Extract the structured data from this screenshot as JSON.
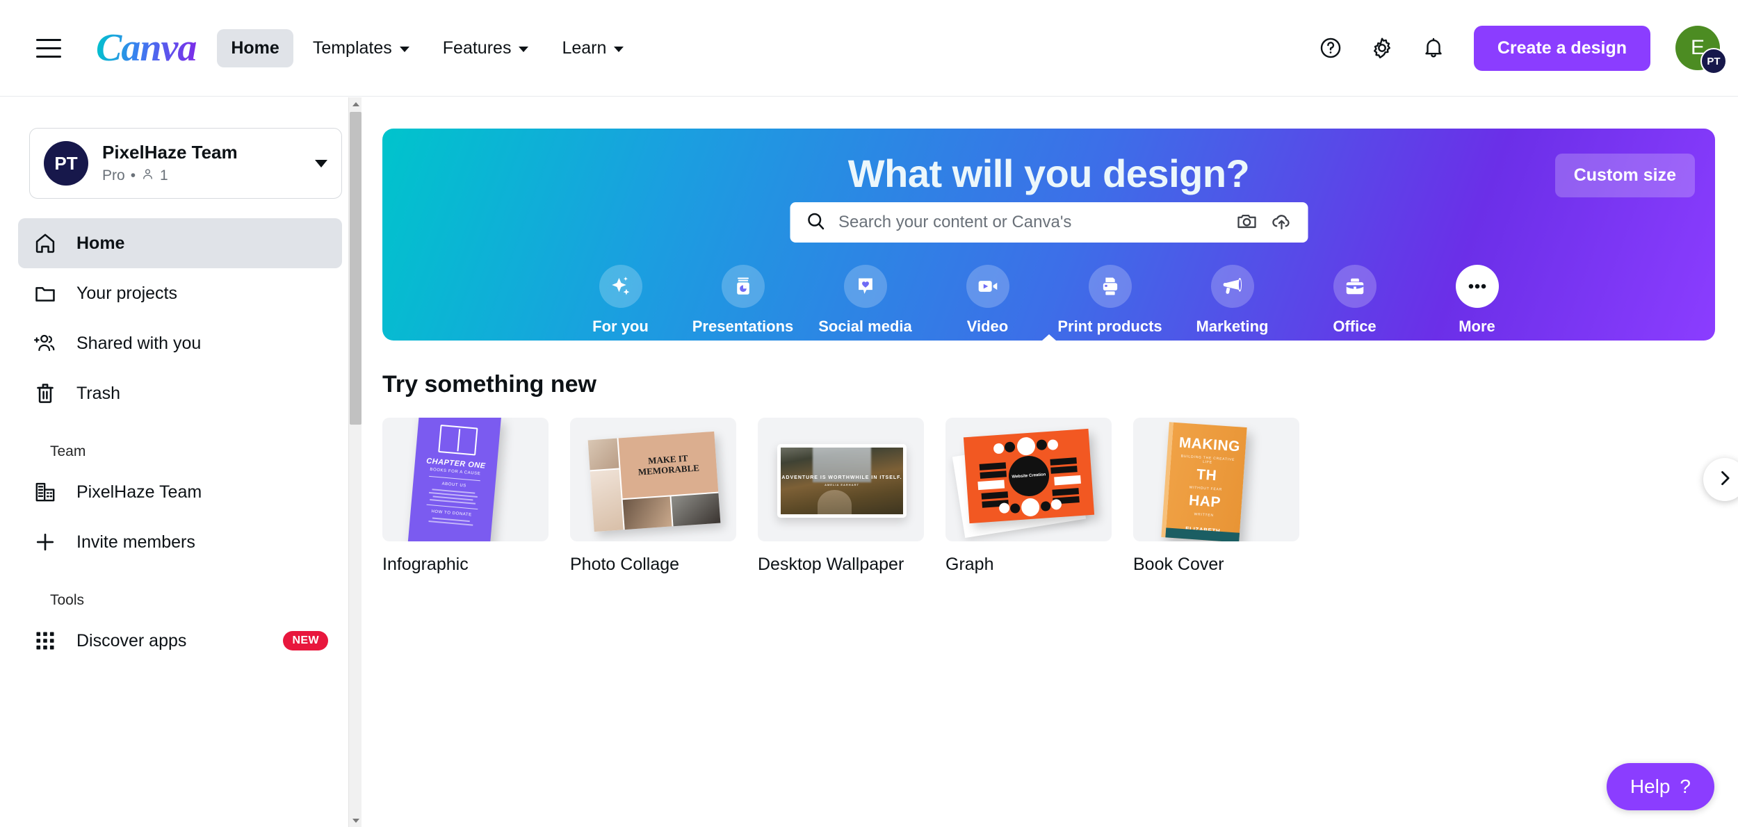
{
  "header": {
    "menu_icon": "hamburger-menu-icon",
    "logo_text": "Canva",
    "nav": [
      {
        "label": "Home",
        "active": true,
        "has_caret": false
      },
      {
        "label": "Templates",
        "active": false,
        "has_caret": true
      },
      {
        "label": "Features",
        "active": false,
        "has_caret": true
      },
      {
        "label": "Learn",
        "active": false,
        "has_caret": true
      }
    ],
    "icons": [
      "help-circle-icon",
      "gear-icon",
      "bell-icon"
    ],
    "create_button": "Create a design",
    "avatar_initial": "E",
    "avatar_badge": "PT"
  },
  "sidebar": {
    "team": {
      "initials": "PT",
      "name": "PixelHaze Team",
      "plan": "Pro",
      "separator": "•",
      "members_count": "1"
    },
    "items": [
      {
        "label": "Home",
        "icon": "home-icon",
        "active": true
      },
      {
        "label": "Your projects",
        "icon": "folder-icon",
        "active": false
      },
      {
        "label": "Shared with you",
        "icon": "add-people-icon",
        "active": false
      },
      {
        "label": "Trash",
        "icon": "trash-icon",
        "active": false
      }
    ],
    "team_heading": "Team",
    "team_items": [
      {
        "label": "PixelHaze Team",
        "icon": "building-icon",
        "badge": ""
      },
      {
        "label": "Invite members",
        "icon": "plus-icon",
        "badge": ""
      }
    ],
    "tools_heading": "Tools",
    "tools_items": [
      {
        "label": "Discover apps",
        "icon": "grid-apps-icon",
        "badge": "NEW"
      }
    ]
  },
  "hero": {
    "title": "What will you design?",
    "custom_size_label": "Custom size",
    "search_placeholder": "Search your content or Canva's",
    "search_value": "",
    "search_icon": "search-icon",
    "camera_icon": "camera-icon",
    "upload_icon": "cloud-upload-icon",
    "categories": [
      {
        "label": "For you",
        "icon": "sparkle-icon"
      },
      {
        "label": "Presentations",
        "icon": "presentation-icon"
      },
      {
        "label": "Social media",
        "icon": "heart-bubble-icon"
      },
      {
        "label": "Video",
        "icon": "video-camera-icon"
      },
      {
        "label": "Print products",
        "icon": "printer-icon"
      },
      {
        "label": "Marketing",
        "icon": "megaphone-icon"
      },
      {
        "label": "Office",
        "icon": "briefcase-icon"
      },
      {
        "label": "More",
        "icon": "ellipsis-icon"
      }
    ]
  },
  "main": {
    "section_title": "Try something new",
    "cards": [
      {
        "label": "Infographic",
        "art": "infographic"
      },
      {
        "label": "Photo Collage",
        "art": "collage"
      },
      {
        "label": "Desktop Wallpaper",
        "art": "wallpaper"
      },
      {
        "label": "Graph",
        "art": "graph"
      },
      {
        "label": "Book Cover",
        "art": "book"
      }
    ],
    "next_arrow_icon": "chevron-right-icon"
  },
  "thumbnails": {
    "infographic": {
      "title": "CHAPTER ONE",
      "subtitle": "BOOKS FOR A CAUSE",
      "section1": "ABOUT US",
      "section2": "HOW TO DONATE"
    },
    "collage": {
      "title": "MAKE IT MEMORABLE"
    },
    "wallpaper": {
      "quote": "ADVENTURE IS WORTHWHILE IN ITSELF.",
      "author": "AMELIA EARHART"
    },
    "graph": {
      "center": "Website Creation"
    },
    "book": {
      "title_line1": "MAKING",
      "title_line2": "TH",
      "title_line3": "HAP",
      "sub1": "BUILDING THE CREATIVE LIFE",
      "sub2": "WITHOUT FEAR",
      "sub3": "WRITTEN",
      "author": "ELIZABETH"
    }
  },
  "help": {
    "label": "Help",
    "symbol": "?"
  },
  "colors": {
    "brand_purple": "#8b3dff",
    "badge_red": "#e8173d",
    "hero_gradient_start": "#00c4cc",
    "hero_gradient_end": "#8b3dff",
    "team_avatar": "#17184b",
    "user_avatar": "#4c8c22"
  }
}
